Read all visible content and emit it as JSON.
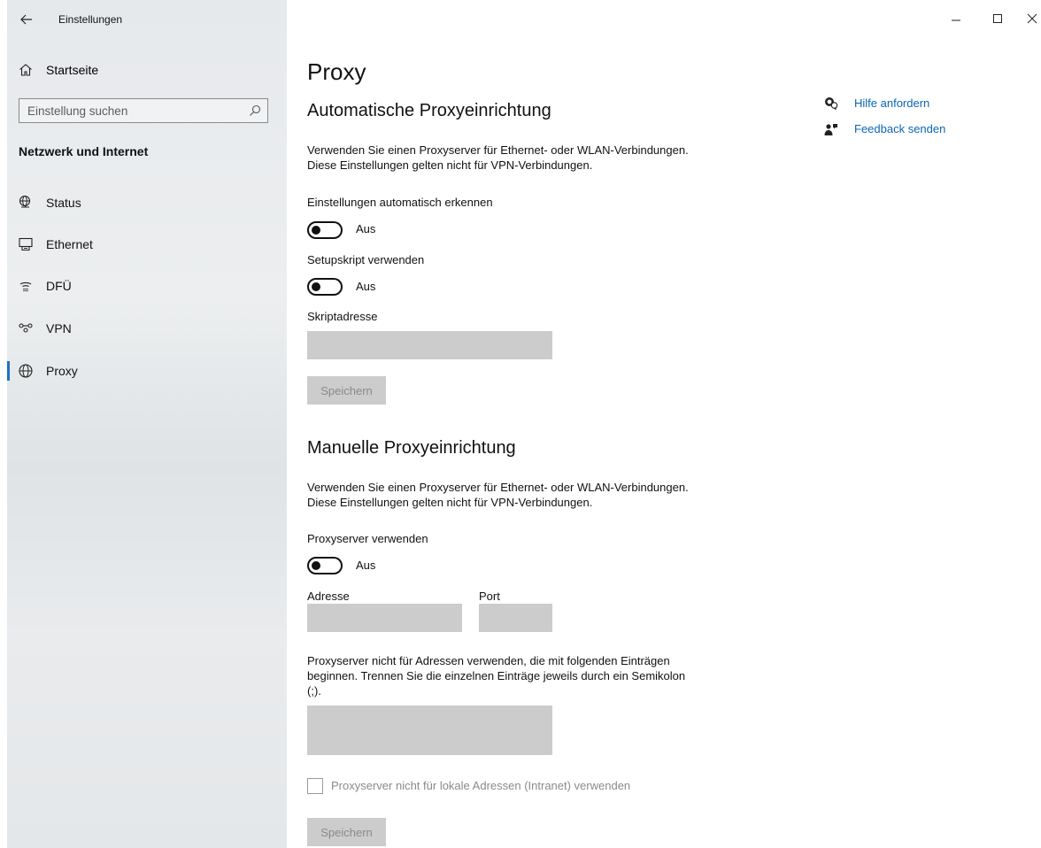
{
  "window": {
    "title": "Einstellungen",
    "controls": {
      "minimize_icon": "minimize-icon",
      "maximize_icon": "maximize-icon",
      "close_icon": "close-icon"
    }
  },
  "sidebar": {
    "home_label": "Startseite",
    "search_placeholder": "Einstellung suchen",
    "section_title": "Netzwerk und Internet",
    "items": [
      {
        "label": "Status",
        "icon": "globe-monitor-icon",
        "selected": false
      },
      {
        "label": "Ethernet",
        "icon": "ethernet-icon",
        "selected": false
      },
      {
        "label": "DFÜ",
        "icon": "dialup-icon",
        "selected": false
      },
      {
        "label": "VPN",
        "icon": "vpn-icon",
        "selected": false
      },
      {
        "label": "Proxy",
        "icon": "globe-icon",
        "selected": true
      }
    ],
    "accent_color": "#1a73c9"
  },
  "main": {
    "page_title": "Proxy",
    "auto": {
      "heading": "Automatische Proxyeinrichtung",
      "description": "Verwenden Sie einen Proxyserver für Ethernet- oder WLAN-Verbindungen. Diese Einstellungen gelten nicht für VPN-Verbindungen.",
      "detect_label": "Einstellungen automatisch erkennen",
      "detect_state": "Aus",
      "script_label": "Setupskript verwenden",
      "script_state": "Aus",
      "address_label": "Skriptadresse",
      "address_value": "",
      "save_label": "Speichern"
    },
    "manual": {
      "heading": "Manuelle Proxyeinrichtung",
      "description": "Verwenden Sie einen Proxyserver für Ethernet- oder WLAN-Verbindungen. Diese Einstellungen gelten nicht für VPN-Verbindungen.",
      "use_label": "Proxyserver verwenden",
      "use_state": "Aus",
      "address_label": "Adresse",
      "address_value": "",
      "port_label": "Port",
      "port_value": "",
      "exceptions_label": "Proxyserver nicht für Adressen verwenden, die mit folgenden Einträgen beginnen. Trennen Sie die einzelnen Einträge jeweils durch ein Semikolon (;).",
      "exceptions_value": "",
      "local_checkbox_label": "Proxyserver nicht für lokale Adressen (Intranet) verwenden",
      "local_checked": false,
      "save_label": "Speichern"
    }
  },
  "help": {
    "get_help": "Hilfe anfordern",
    "feedback": "Feedback senden",
    "link_color": "#0b66b5"
  }
}
